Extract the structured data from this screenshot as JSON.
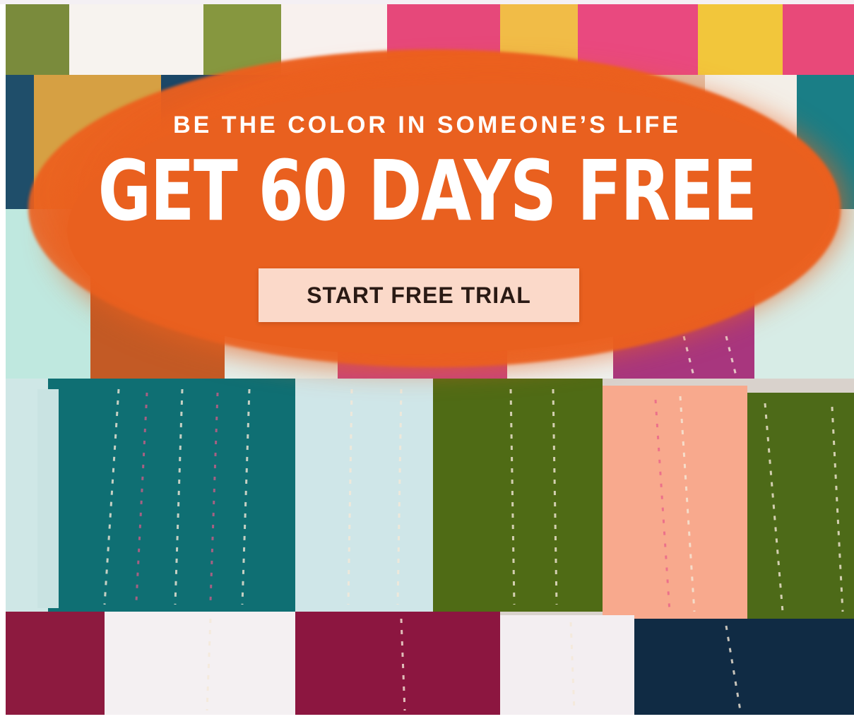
{
  "banner": {
    "tagline": "BE THE COLOR IN SOMEONE’S LIFE",
    "headline": "GET 60 DAYS FREE",
    "cta_label": "START FREE TRIAL"
  },
  "colors": {
    "accent_orange": "#e9601f",
    "cta_background": "#fbd9c9",
    "text_white": "#ffffff"
  },
  "image": {
    "subject": "colorful-quilt-photo"
  }
}
